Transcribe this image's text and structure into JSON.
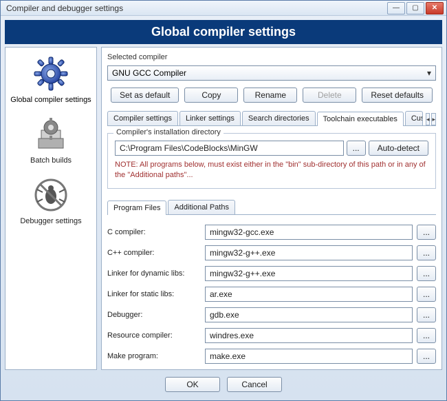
{
  "window": {
    "title": "Compiler and debugger settings"
  },
  "header": "Global compiler settings",
  "sidebar": {
    "items": [
      {
        "label": "Global compiler settings"
      },
      {
        "label": "Batch builds"
      },
      {
        "label": "Debugger settings"
      }
    ]
  },
  "selectedCompiler": {
    "label": "Selected compiler",
    "value": "GNU GCC Compiler",
    "buttons": {
      "set_default": "Set as default",
      "copy": "Copy",
      "rename": "Rename",
      "delete": "Delete",
      "reset": "Reset defaults"
    }
  },
  "tabs": [
    {
      "label": "Compiler settings"
    },
    {
      "label": "Linker settings"
    },
    {
      "label": "Search directories"
    },
    {
      "label": "Toolchain executables"
    },
    {
      "label": "Custom va"
    }
  ],
  "installDir": {
    "legend": "Compiler's installation directory",
    "path": "C:\\Program Files\\CodeBlocks\\MinGW",
    "browse": "...",
    "autodetect": "Auto-detect",
    "note": "NOTE: All programs below, must exist either in the \"bin\" sub-directory of this path or in any of the \"Additional paths\"..."
  },
  "subtabs": [
    {
      "label": "Program Files"
    },
    {
      "label": "Additional Paths"
    }
  ],
  "programFiles": [
    {
      "label": "C compiler:",
      "value": "mingw32-gcc.exe"
    },
    {
      "label": "C++ compiler:",
      "value": "mingw32-g++.exe"
    },
    {
      "label": "Linker for dynamic libs:",
      "value": "mingw32-g++.exe"
    },
    {
      "label": "Linker for static libs:",
      "value": "ar.exe"
    },
    {
      "label": "Debugger:",
      "value": "gdb.exe"
    },
    {
      "label": "Resource compiler:",
      "value": "windres.exe"
    },
    {
      "label": "Make program:",
      "value": "make.exe"
    }
  ],
  "browseBtn": "...",
  "footer": {
    "ok": "OK",
    "cancel": "Cancel"
  }
}
